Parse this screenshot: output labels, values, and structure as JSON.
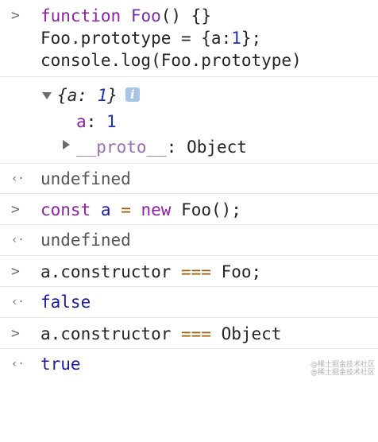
{
  "console": {
    "entry1": {
      "l1": {
        "kw": "function",
        "name": "Foo",
        "rest": "() {}"
      },
      "l2": {
        "a": "Foo.prototype = {a:",
        "num": "1",
        "b": "};"
      },
      "l3": "console.log(Foo.prototype)"
    },
    "object_preview": {
      "open": "{a: ",
      "num": "1",
      "close": "}",
      "info": "i",
      "prop_name": "a",
      "prop_sep": ": ",
      "prop_value": "1",
      "proto_name": "__proto__",
      "proto_value": ": Object"
    },
    "result1": "undefined",
    "entry2": {
      "kw": "const",
      "var": "a",
      "eq": "=",
      "kw2": "new",
      "call": "Foo();"
    },
    "result2": "undefined",
    "entry3": {
      "left": "a.constructor ",
      "op": "===",
      "right": " Foo;"
    },
    "result3": "false",
    "entry4": {
      "left": "a.constructor ",
      "op": "===",
      "right": " Object"
    },
    "result4": "true",
    "prompt_icon": "chevron-right-icon",
    "result_icon": "return-arrow-icon",
    "prompt_glyph": ">",
    "result_glyph": "‹·"
  },
  "watermark": [
    "@稀土掘金技术社区",
    "@稀土掘金技术社区"
  ]
}
